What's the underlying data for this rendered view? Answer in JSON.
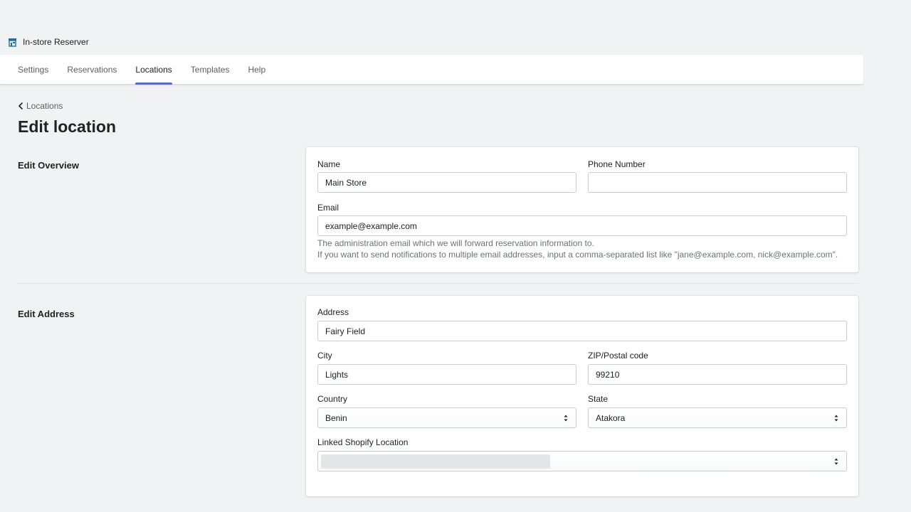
{
  "app": {
    "title": "In-store Reserver"
  },
  "tabs": [
    {
      "label": "Settings"
    },
    {
      "label": "Reservations"
    },
    {
      "label": "Locations"
    },
    {
      "label": "Templates"
    },
    {
      "label": "Help"
    }
  ],
  "active_tab": "Locations",
  "breadcrumb": {
    "label": "Locations"
  },
  "page": {
    "title": "Edit location"
  },
  "overview": {
    "section_title": "Edit Overview",
    "name_label": "Name",
    "name_value": "Main Store",
    "phone_label": "Phone Number",
    "phone_value": "",
    "email_label": "Email",
    "email_value": "example@example.com",
    "help_line1": "The administration email which we will forward reservation information to.",
    "help_line2": "If you want to send notifications to multiple email addresses, input a comma-separated list like \"jane@example.com, nick@example.com\"."
  },
  "address": {
    "section_title": "Edit Address",
    "address_label": "Address",
    "address_value": "Fairy Field",
    "city_label": "City",
    "city_value": "Lights",
    "zip_label": "ZIP/Postal code",
    "zip_value": "99210",
    "country_label": "Country",
    "country_value": "Benin",
    "state_label": "State",
    "state_value": "Atakora",
    "linked_label": "Linked Shopify Location",
    "linked_value": ""
  },
  "colors": {
    "accent": "#5c6ac4",
    "background": "#f1f2f4"
  }
}
